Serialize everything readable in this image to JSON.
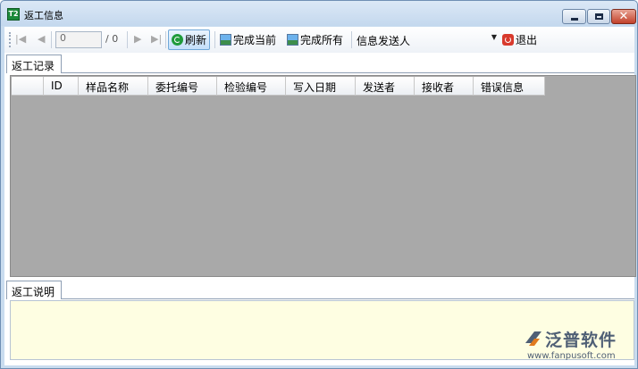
{
  "window": {
    "icon_text": "T2",
    "title": "返工信息",
    "close_glyph": "✕"
  },
  "toolbar": {
    "first_glyph": "|◀",
    "prev_glyph": "◀",
    "page_value": "0",
    "page_total": "/ 0",
    "next_glyph": "▶",
    "last_glyph": "▶|",
    "refresh_label": "刷新",
    "complete_current_label": "完成当前",
    "complete_all_label": "完成所有",
    "sender_combo_value": "信息发送人",
    "exit_label": "退出"
  },
  "records_tab": {
    "label": "返工记录",
    "columns": [
      "",
      "ID",
      "样品名称",
      "委托编号",
      "检验编号",
      "写入日期",
      "发送者",
      "接收者",
      "错误信息"
    ]
  },
  "notes_tab": {
    "label": "返工说明",
    "value": ""
  },
  "watermark": {
    "name": "泛普软件",
    "url": "www.fanpusoft.com"
  },
  "colors": {
    "grid_background": "#a9a9a9",
    "memo_background": "#fefee2",
    "title_bar": "#c9dcef",
    "close_button": "#c2412a"
  }
}
